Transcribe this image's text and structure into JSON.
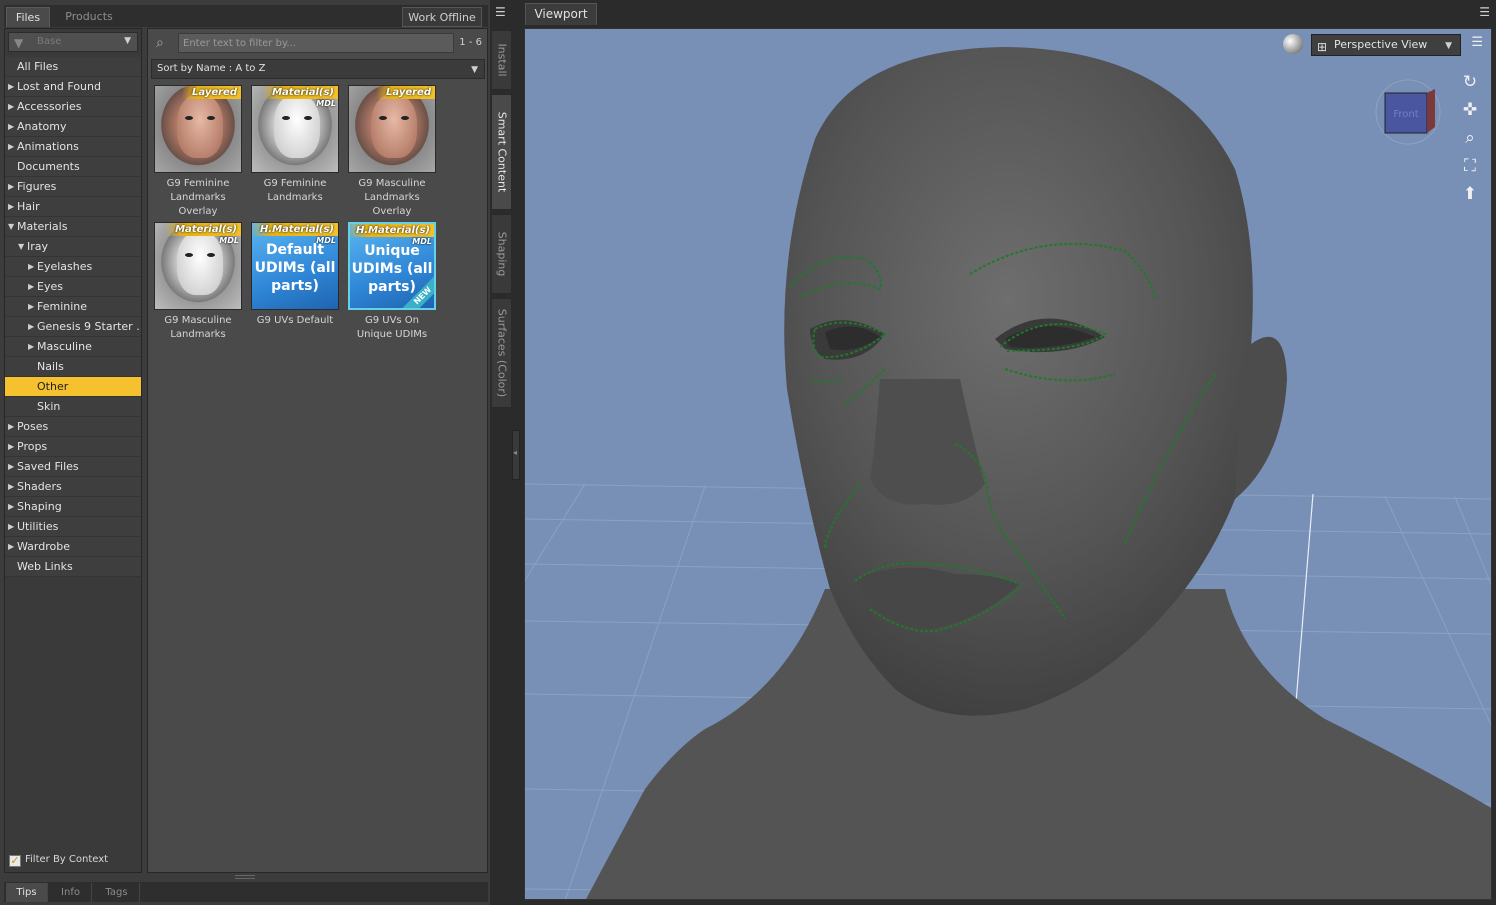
{
  "left_panel": {
    "tabs": [
      "Files",
      "Products"
    ],
    "work_offline": "Work Offline",
    "base_filter": "Base",
    "tree": [
      {
        "label": "All Files",
        "arrow": "",
        "level": 0
      },
      {
        "label": "Lost and Found",
        "arrow": "▶",
        "level": 0
      },
      {
        "label": "Accessories",
        "arrow": "▶",
        "level": 0
      },
      {
        "label": "Anatomy",
        "arrow": "▶",
        "level": 0
      },
      {
        "label": "Animations",
        "arrow": "▶",
        "level": 0
      },
      {
        "label": "Documents",
        "arrow": "",
        "level": 0
      },
      {
        "label": "Figures",
        "arrow": "▶",
        "level": 0
      },
      {
        "label": "Hair",
        "arrow": "▶",
        "level": 0
      },
      {
        "label": "Materials",
        "arrow": "▼",
        "level": 0
      },
      {
        "label": "Iray",
        "arrow": "▼",
        "level": 1
      },
      {
        "label": "Eyelashes",
        "arrow": "▶",
        "level": 2
      },
      {
        "label": "Eyes",
        "arrow": "▶",
        "level": 2
      },
      {
        "label": "Feminine",
        "arrow": "▶",
        "level": 2
      },
      {
        "label": "Genesis 9 Starter ...",
        "arrow": "▶",
        "level": 2
      },
      {
        "label": "Masculine",
        "arrow": "▶",
        "level": 2
      },
      {
        "label": "Nails",
        "arrow": "",
        "level": 2
      },
      {
        "label": "Other",
        "arrow": "",
        "level": 2,
        "selected": true
      },
      {
        "label": "Skin",
        "arrow": "",
        "level": 2
      },
      {
        "label": "Poses",
        "arrow": "▶",
        "level": 0
      },
      {
        "label": "Props",
        "arrow": "▶",
        "level": 0
      },
      {
        "label": "Saved Files",
        "arrow": "▶",
        "level": 0
      },
      {
        "label": "Shaders",
        "arrow": "▶",
        "level": 0
      },
      {
        "label": "Shaping",
        "arrow": "▶",
        "level": 0
      },
      {
        "label": "Utilities",
        "arrow": "▶",
        "level": 0
      },
      {
        "label": "Wardrobe",
        "arrow": "▶",
        "level": 0
      },
      {
        "label": "Web Links",
        "arrow": "",
        "level": 0
      }
    ],
    "filter_by_context": "Filter By Context",
    "search_placeholder": "Enter text to filter by...",
    "result_range": "1 - 6",
    "sort": "Sort by Name : A to Z",
    "items": [
      {
        "title": "G9 Feminine Landmarks Overlay",
        "badge": "Layered",
        "mdl": "",
        "style": "face",
        "big_text": "",
        "new": false
      },
      {
        "title": "G9 Feminine Landmarks",
        "badge": "Material(s)",
        "mdl": "MDL",
        "style": "mdl",
        "big_text": "",
        "new": false
      },
      {
        "title": "G9 Masculine Landmarks Overlay",
        "badge": "Layered",
        "mdl": "",
        "style": "face",
        "big_text": "",
        "new": false
      },
      {
        "title": "G9 Masculine Landmarks",
        "badge": "Material(s)",
        "mdl": "MDL",
        "style": "mdl",
        "big_text": "",
        "new": false
      },
      {
        "title": "G9 UVs Default",
        "badge": "H.Material(s)",
        "mdl": "MDL",
        "style": "uv",
        "big_text": "Default UDIMs (all parts)",
        "new": false
      },
      {
        "title": "G9 UVs On Unique UDIMs",
        "badge": "H.Material(s)",
        "mdl": "MDL",
        "style": "uv sel",
        "big_text": "Unique UDIMs (all parts)",
        "new": true,
        "new_label": "NEW"
      }
    ],
    "bottom_tabs": [
      "Tips",
      "Info",
      "Tags"
    ]
  },
  "side_tabs": [
    "Install",
    "Smart Content",
    "Shaping",
    "Surfaces (Color)"
  ],
  "viewport": {
    "tab": "Viewport",
    "view_mode": "Perspective View",
    "cube_face": "Front",
    "background_color": "#7890b6",
    "figure_color": "#5a5a5a",
    "landmark_color": "#1f7a2a"
  },
  "icons": {
    "filter": "filter-icon",
    "search": "search-icon",
    "orbit": "orbit-icon",
    "pan": "pan-icon",
    "zoom": "zoom-icon",
    "frame": "frame-icon",
    "reset": "reset-camera-icon"
  }
}
